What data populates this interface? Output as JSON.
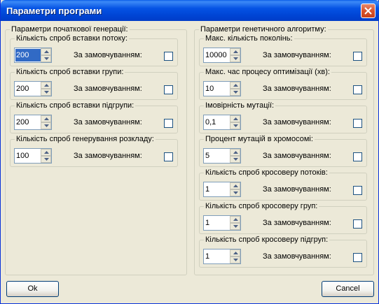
{
  "window": {
    "title": "Параметри програми"
  },
  "left_group": {
    "title": "Параметри початкової генерації:",
    "items": [
      {
        "label": "Кількість спроб вставки потоку:",
        "value": "200",
        "selected": true,
        "default_label": "За замовчуванням:"
      },
      {
        "label": "Кількість спроб вставки групи:",
        "value": "200",
        "selected": false,
        "default_label": "За замовчуванням:"
      },
      {
        "label": "Кількість спроб вставки підгрупи:",
        "value": "200",
        "selected": false,
        "default_label": "За замовчуванням:"
      },
      {
        "label": "Кількість спроб генерування розкладу:",
        "value": "100",
        "selected": false,
        "default_label": "За замовчуванням:"
      }
    ]
  },
  "right_group": {
    "title": "Параметри генетичного алгоритму:",
    "items": [
      {
        "label": "Макс. кількість поколінь:",
        "value": "10000",
        "default_label": "За замовчуванням:"
      },
      {
        "label": "Макс. час процесу оптимізації (хв):",
        "value": "10",
        "default_label": "За замовчуванням:"
      },
      {
        "label": "Імовірність мутації:",
        "value": "0,1",
        "default_label": "За замовчуванням:"
      },
      {
        "label": "Процент мутацій в хромосомі:",
        "value": "5",
        "default_label": "За замовчуванням:"
      },
      {
        "label": "Кількість спроб кросоверу потоків:",
        "value": "1",
        "default_label": "За замовчуванням:"
      },
      {
        "label": "Кількість спроб кросоверу груп:",
        "value": "1",
        "default_label": "За замовчуванням:"
      },
      {
        "label": "Кількість спроб кросоверу підгруп:",
        "value": "1",
        "default_label": "За замовчуванням:"
      }
    ]
  },
  "buttons": {
    "ok": "Ok",
    "cancel": "Cancel"
  }
}
